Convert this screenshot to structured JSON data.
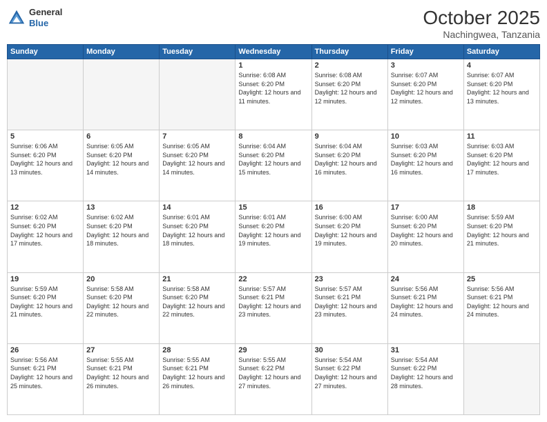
{
  "header": {
    "logo": {
      "general": "General",
      "blue": "Blue"
    },
    "month_year": "October 2025",
    "location": "Nachingwea, Tanzania"
  },
  "days_of_week": [
    "Sunday",
    "Monday",
    "Tuesday",
    "Wednesday",
    "Thursday",
    "Friday",
    "Saturday"
  ],
  "weeks": [
    [
      {
        "day": "",
        "empty": true
      },
      {
        "day": "",
        "empty": true
      },
      {
        "day": "",
        "empty": true
      },
      {
        "day": "1",
        "sunrise": "6:08 AM",
        "sunset": "6:20 PM",
        "daylight": "12 hours and 11 minutes."
      },
      {
        "day": "2",
        "sunrise": "6:08 AM",
        "sunset": "6:20 PM",
        "daylight": "12 hours and 12 minutes."
      },
      {
        "day": "3",
        "sunrise": "6:07 AM",
        "sunset": "6:20 PM",
        "daylight": "12 hours and 12 minutes."
      },
      {
        "day": "4",
        "sunrise": "6:07 AM",
        "sunset": "6:20 PM",
        "daylight": "12 hours and 13 minutes."
      }
    ],
    [
      {
        "day": "5",
        "sunrise": "6:06 AM",
        "sunset": "6:20 PM",
        "daylight": "12 hours and 13 minutes."
      },
      {
        "day": "6",
        "sunrise": "6:05 AM",
        "sunset": "6:20 PM",
        "daylight": "12 hours and 14 minutes."
      },
      {
        "day": "7",
        "sunrise": "6:05 AM",
        "sunset": "6:20 PM",
        "daylight": "12 hours and 14 minutes."
      },
      {
        "day": "8",
        "sunrise": "6:04 AM",
        "sunset": "6:20 PM",
        "daylight": "12 hours and 15 minutes."
      },
      {
        "day": "9",
        "sunrise": "6:04 AM",
        "sunset": "6:20 PM",
        "daylight": "12 hours and 16 minutes."
      },
      {
        "day": "10",
        "sunrise": "6:03 AM",
        "sunset": "6:20 PM",
        "daylight": "12 hours and 16 minutes."
      },
      {
        "day": "11",
        "sunrise": "6:03 AM",
        "sunset": "6:20 PM",
        "daylight": "12 hours and 17 minutes."
      }
    ],
    [
      {
        "day": "12",
        "sunrise": "6:02 AM",
        "sunset": "6:20 PM",
        "daylight": "12 hours and 17 minutes."
      },
      {
        "day": "13",
        "sunrise": "6:02 AM",
        "sunset": "6:20 PM",
        "daylight": "12 hours and 18 minutes."
      },
      {
        "day": "14",
        "sunrise": "6:01 AM",
        "sunset": "6:20 PM",
        "daylight": "12 hours and 18 minutes."
      },
      {
        "day": "15",
        "sunrise": "6:01 AM",
        "sunset": "6:20 PM",
        "daylight": "12 hours and 19 minutes."
      },
      {
        "day": "16",
        "sunrise": "6:00 AM",
        "sunset": "6:20 PM",
        "daylight": "12 hours and 19 minutes."
      },
      {
        "day": "17",
        "sunrise": "6:00 AM",
        "sunset": "6:20 PM",
        "daylight": "12 hours and 20 minutes."
      },
      {
        "day": "18",
        "sunrise": "5:59 AM",
        "sunset": "6:20 PM",
        "daylight": "12 hours and 21 minutes."
      }
    ],
    [
      {
        "day": "19",
        "sunrise": "5:59 AM",
        "sunset": "6:20 PM",
        "daylight": "12 hours and 21 minutes."
      },
      {
        "day": "20",
        "sunrise": "5:58 AM",
        "sunset": "6:20 PM",
        "daylight": "12 hours and 22 minutes."
      },
      {
        "day": "21",
        "sunrise": "5:58 AM",
        "sunset": "6:20 PM",
        "daylight": "12 hours and 22 minutes."
      },
      {
        "day": "22",
        "sunrise": "5:57 AM",
        "sunset": "6:21 PM",
        "daylight": "12 hours and 23 minutes."
      },
      {
        "day": "23",
        "sunrise": "5:57 AM",
        "sunset": "6:21 PM",
        "daylight": "12 hours and 23 minutes."
      },
      {
        "day": "24",
        "sunrise": "5:56 AM",
        "sunset": "6:21 PM",
        "daylight": "12 hours and 24 minutes."
      },
      {
        "day": "25",
        "sunrise": "5:56 AM",
        "sunset": "6:21 PM",
        "daylight": "12 hours and 24 minutes."
      }
    ],
    [
      {
        "day": "26",
        "sunrise": "5:56 AM",
        "sunset": "6:21 PM",
        "daylight": "12 hours and 25 minutes."
      },
      {
        "day": "27",
        "sunrise": "5:55 AM",
        "sunset": "6:21 PM",
        "daylight": "12 hours and 26 minutes."
      },
      {
        "day": "28",
        "sunrise": "5:55 AM",
        "sunset": "6:21 PM",
        "daylight": "12 hours and 26 minutes."
      },
      {
        "day": "29",
        "sunrise": "5:55 AM",
        "sunset": "6:22 PM",
        "daylight": "12 hours and 27 minutes."
      },
      {
        "day": "30",
        "sunrise": "5:54 AM",
        "sunset": "6:22 PM",
        "daylight": "12 hours and 27 minutes."
      },
      {
        "day": "31",
        "sunrise": "5:54 AM",
        "sunset": "6:22 PM",
        "daylight": "12 hours and 28 minutes."
      },
      {
        "day": "",
        "empty": true
      }
    ]
  ],
  "labels": {
    "sunrise": "Sunrise:",
    "sunset": "Sunset:",
    "daylight": "Daylight:"
  }
}
